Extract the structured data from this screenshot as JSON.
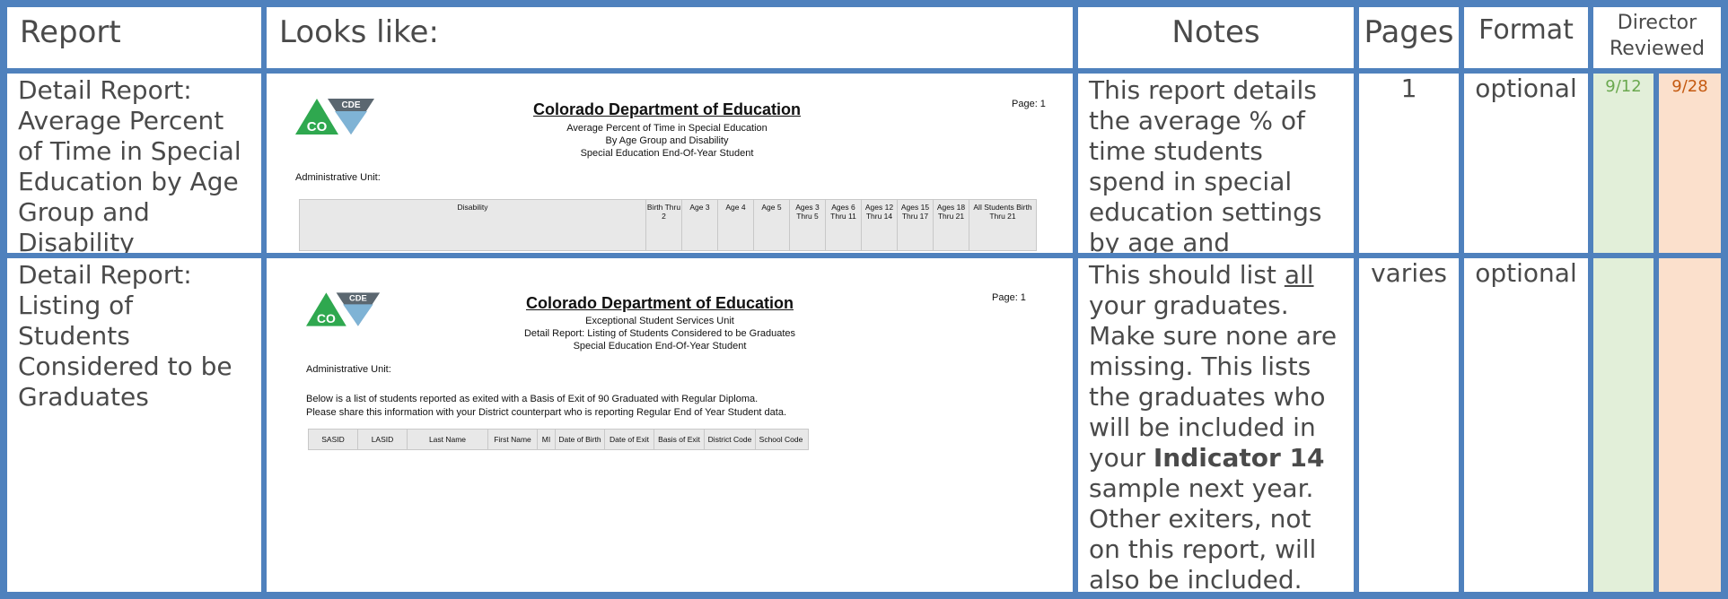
{
  "headers": {
    "report": "Report",
    "looks_like": "Looks like:",
    "notes": "Notes",
    "pages": "Pages",
    "format": "Format",
    "director_line1": "Director",
    "director_line2": "Reviewed"
  },
  "colors": {
    "border": "#4f81bd",
    "green": "#e2efd9",
    "orange": "#fbe0cc"
  },
  "rows": [
    {
      "report": "Detail Report: Average Percent of Time in Special Education by Age Group and Disability",
      "notes": "This report details the average % of time students spend in special education settings by age and disability",
      "pages": "1",
      "format": "optional",
      "reviewed_1": "9/12",
      "reviewed_2": "9/28",
      "preview": {
        "logo_text": "CDE",
        "logo_co": "CO",
        "title": "Colorado Department of Education",
        "sub1": "Average Percent of Time in Special Education",
        "sub2": "By Age Group and Disability",
        "sub3": "Special Education End-Of-Year Student",
        "page": "Page: 1",
        "admin_unit": "Administrative Unit:",
        "columns": [
          "Disability",
          "Birth Thru 2",
          "Age 3",
          "Age 4",
          "Age 5",
          "Ages 3 Thru 5",
          "Ages 6 Thru 11",
          "Ages 12 Thru 14",
          "Ages 15 Thru 17",
          "Ages 18 Thru 21",
          "All Students Birth Thru 21"
        ]
      }
    },
    {
      "report": "Detail Report: Listing of Students Considered to be Graduates",
      "notes_1": "This should list ",
      "notes_all": "all",
      "notes_2": " your graduates. Make sure none are missing.  This lists the graduates who will be included in your ",
      "notes_bold": "Indicator 14",
      "notes_3": " sample next year. Other exiters, not on this report, will also be included.",
      "pages": "varies",
      "format": "optional",
      "reviewed_1": "",
      "reviewed_2": "",
      "preview": {
        "logo_text": "CDE",
        "logo_co": "CO",
        "title": "Colorado Department of Education",
        "sub1": "Exceptional Student Services Unit",
        "sub2": "Detail Report: Listing of Students Considered to be Graduates",
        "sub3": "Special Education End-Of-Year Student",
        "page": "Page: 1",
        "admin_unit": "Administrative Unit:",
        "para1": "Below is a list of students reported as exited with a Basis of Exit of 90 Graduated with Regular Diploma.",
        "para2": "Please share this information with your District counterpart who is reporting Regular End of Year Student data.",
        "columns": [
          "SASID",
          "LASID",
          "Last Name",
          "First Name",
          "MI",
          "Date of Birth",
          "Date of Exit",
          "Basis of Exit",
          "District Code",
          "School Code"
        ]
      }
    }
  ]
}
